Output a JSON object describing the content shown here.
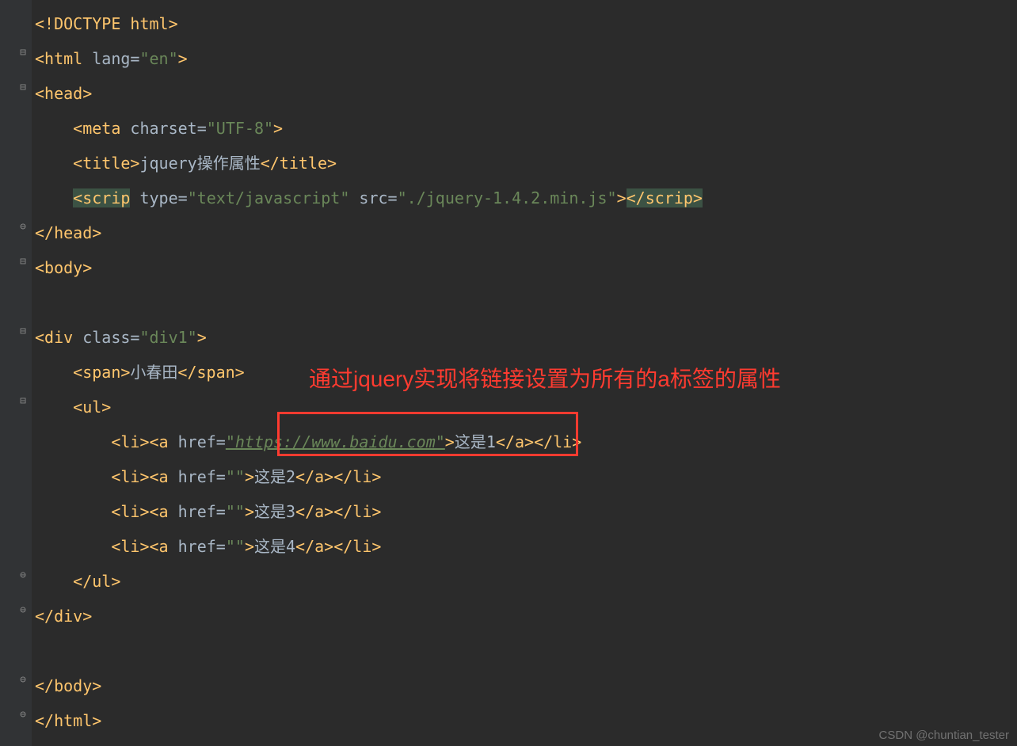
{
  "code": {
    "l1": {
      "doctype": "<!DOCTYPE html>"
    },
    "l2": {
      "open": "<html ",
      "attr": "lang=",
      "val": "\"en\"",
      "close": ">"
    },
    "l3": {
      "open": "<head>"
    },
    "l4": {
      "open": "<meta ",
      "attr": "charset=",
      "val": "\"UTF-8\"",
      "close": ">"
    },
    "l5": {
      "open": "<title>",
      "text": "jquery操作属性",
      "close": "</title>"
    },
    "l6": {
      "open": "<scrip",
      "sp": " ",
      "attr1": "type=",
      "val1": "\"text/javascript\"",
      "attr2": " src=",
      "val2": "\"./jquery-1.4.2.min.js\"",
      "mid": ">",
      "close": "</scrip>"
    },
    "l7": {
      "open": "</head>"
    },
    "l8": {
      "open": "<body>"
    },
    "l10": {
      "open": "<div ",
      "attr": "class=",
      "val": "\"div1\"",
      "close": ">"
    },
    "l11": {
      "open": "<span>",
      "text": "小春田",
      "close": "</span>"
    },
    "l12": {
      "open": "<ul>"
    },
    "l13": {
      "liopen": "<li>",
      "aopen": "<a ",
      "hrefattr": "href=",
      "hrefval": "\"https://www.baidu.com\"",
      "aclose": ">",
      "text": "这是1",
      "aend": "</a>",
      "liend": "</li>"
    },
    "l14": {
      "liopen": "<li>",
      "aopen": "<a ",
      "hrefattr": "href=",
      "hrefval": "\"\"",
      "aclose": ">",
      "text": "这是2",
      "aend": "</a>",
      "liend": "</li>"
    },
    "l15": {
      "liopen": "<li>",
      "aopen": "<a ",
      "hrefattr": "href=",
      "hrefval": "\"\"",
      "aclose": ">",
      "text": "这是3",
      "aend": "</a>",
      "liend": "</li>"
    },
    "l16": {
      "liopen": "<li>",
      "aopen": "<a ",
      "hrefattr": "href=",
      "hrefval": "\"\"",
      "aclose": ">",
      "text": "这是4",
      "aend": "</a>",
      "liend": "</li>"
    },
    "l17": {
      "open": "</ul>"
    },
    "l18": {
      "open": "</div>"
    },
    "l20": {
      "open": "</body>"
    },
    "l21": {
      "open": "</html>"
    }
  },
  "annotation": "通过jquery实现将链接设置为所有的a标签的属性",
  "watermark": "CSDN @chuntian_tester"
}
